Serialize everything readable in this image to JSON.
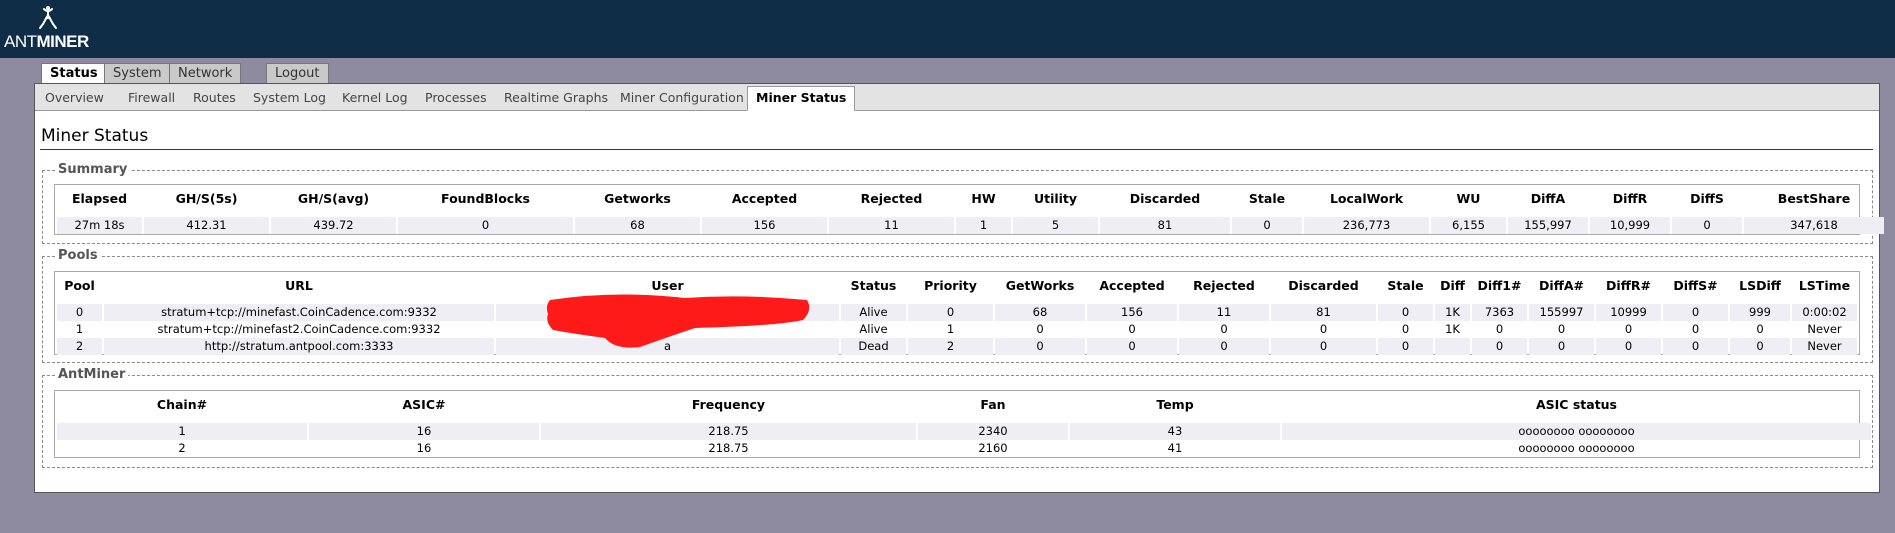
{
  "brand": {
    "prefix": "ANT",
    "suffix": "MINER"
  },
  "main_tabs": [
    "Status",
    "System",
    "Network",
    "Logout"
  ],
  "sub_tabs": [
    "Overview",
    "Firewall",
    "Routes",
    "System Log",
    "Kernel Log",
    "Processes",
    "Realtime Graphs",
    "Miner Configuration",
    "Miner Status"
  ],
  "page_title": "Miner Status",
  "summary": {
    "legend": "Summary",
    "headers": [
      "Elapsed",
      "GH/S(5s)",
      "GH/S(avg)",
      "FoundBlocks",
      "Getworks",
      "Accepted",
      "Rejected",
      "HW",
      "Utility",
      "Discarded",
      "Stale",
      "LocalWork",
      "WU",
      "DiffA",
      "DiffR",
      "DiffS",
      "BestShare"
    ],
    "row": [
      "27m 18s",
      "412.31",
      "439.72",
      "0",
      "68",
      "156",
      "11",
      "1",
      "5",
      "81",
      "0",
      "236,773",
      "6,155",
      "155,997",
      "10,999",
      "0",
      "347,618"
    ]
  },
  "pools": {
    "legend": "Pools",
    "headers": [
      "Pool",
      "URL",
      "User",
      "Status",
      "Priority",
      "GetWorks",
      "Accepted",
      "Rejected",
      "Discarded",
      "Stale",
      "Diff",
      "Diff1#",
      "DiffA#",
      "DiffR#",
      "DiffS#",
      "LSDiff",
      "LSTime"
    ],
    "rows": [
      [
        "0",
        "stratum+tcp://minefast.CoinCadence.com:9332",
        "",
        "Alive",
        "0",
        "68",
        "156",
        "11",
        "81",
        "0",
        "1K",
        "7363",
        "155997",
        "10999",
        "0",
        "999",
        "0:00:02"
      ],
      [
        "1",
        "stratum+tcp://minefast2.CoinCadence.com:9332",
        "",
        "Alive",
        "1",
        "0",
        "0",
        "0",
        "0",
        "0",
        "1K",
        "0",
        "0",
        "0",
        "0",
        "0",
        "Never"
      ],
      [
        "2",
        "http://stratum.antpool.com:3333",
        "a",
        "Dead",
        "2",
        "0",
        "0",
        "0",
        "0",
        "0",
        "",
        "0",
        "0",
        "0",
        "0",
        "0",
        "Never"
      ]
    ]
  },
  "antminer": {
    "legend": "AntMiner",
    "headers": [
      "Chain#",
      "ASIC#",
      "Frequency",
      "Fan",
      "Temp",
      "ASIC status"
    ],
    "rows": [
      [
        "1",
        "16",
        "218.75",
        "2340",
        "43",
        "oooooooo oooooooo"
      ],
      [
        "2",
        "16",
        "218.75",
        "2160",
        "41",
        "oooooooo oooooooo"
      ]
    ]
  },
  "colors": {
    "header_bg": "#0f2d46",
    "page_bg": "#8e8aa0",
    "row_alt": "#eeeef4",
    "redaction": "#ff1a1a"
  }
}
